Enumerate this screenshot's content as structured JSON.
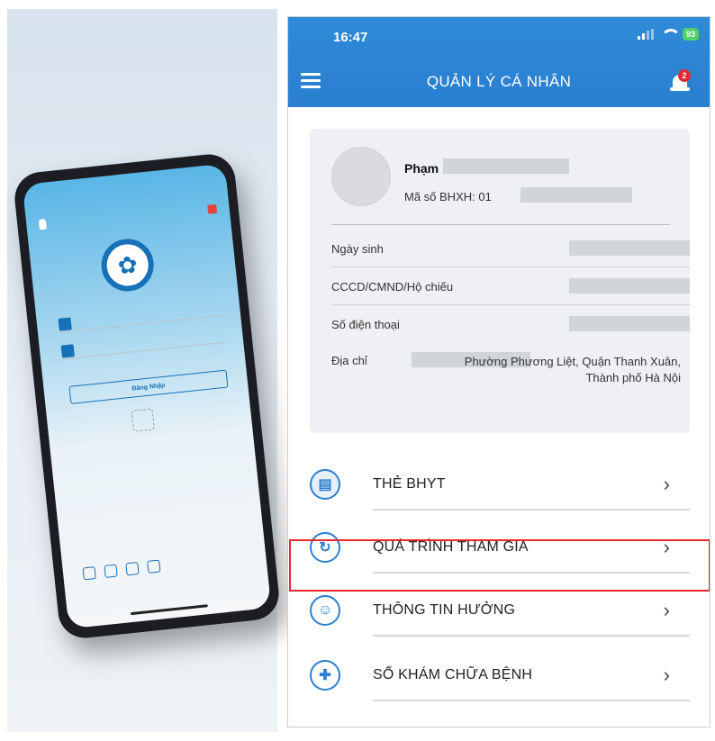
{
  "promo_phone": {
    "signin_button": "Đăng Nhập"
  },
  "app": {
    "status_bar": {
      "time": "16:47",
      "battery": "93"
    },
    "header": {
      "title": "QUẢN LÝ CÁ NHÂN",
      "notification_count": "2"
    },
    "profile": {
      "name_prefix": "Phạm",
      "id_label": "Mã số BHXH: 01",
      "fields": [
        {
          "label": "Ngày sinh"
        },
        {
          "label": "CCCD/CMND/Hộ chiếu"
        },
        {
          "label": "Số điện thoại"
        }
      ],
      "address_label": "Địa chỉ",
      "address_value": "Phường Phương Liệt, Quận Thanh Xuân, Thành phố Hà Nội"
    },
    "menu": [
      {
        "label": "THẺ BHYT",
        "icon": "health-card-icon"
      },
      {
        "label": "QUÁ TRÌNH THAM GIA",
        "icon": "refresh-icon",
        "highlighted": true
      },
      {
        "label": "THÔNG TIN HƯỞNG",
        "icon": "user-benefit-icon"
      },
      {
        "label": "SỔ KHÁM CHỮA BỆNH",
        "icon": "medical-cross-icon"
      }
    ],
    "colors": {
      "header_blue": "#2a7fd0",
      "highlight_red": "#e3282e"
    }
  }
}
